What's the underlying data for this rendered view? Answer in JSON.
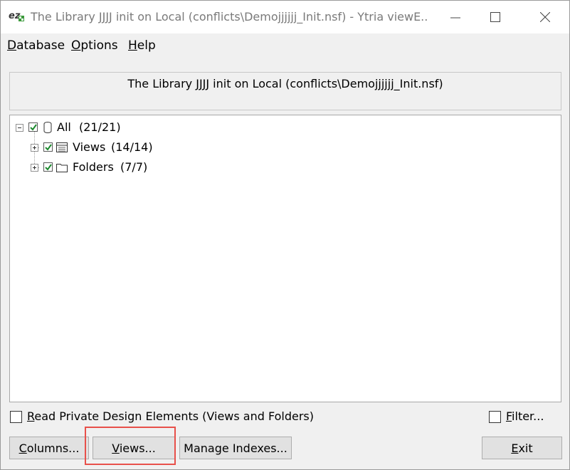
{
  "window": {
    "title": "The Library JJJJ init on Local (conflicts\\Demojjjjjj_Init.nsf) - Ytria viewE...",
    "app_icon": "ez-app-icon",
    "controls": [
      "minimize-icon",
      "maximize-icon",
      "close-icon"
    ]
  },
  "menu": {
    "items": [
      {
        "accel": "D",
        "rest": "atabase"
      },
      {
        "accel": "O",
        "rest": "ptions"
      },
      {
        "accel": "H",
        "rest": "elp"
      }
    ]
  },
  "header": {
    "text": "The Library JJJJ init on Local (conflicts\\Demojjjjjj_Init.nsf)"
  },
  "tree": {
    "root": {
      "label": "All",
      "count": "(21/21)",
      "checked": true,
      "icon": "database-icon",
      "expanded": true
    },
    "children": [
      {
        "label": "Views",
        "count": "(14/14)",
        "checked": true,
        "icon": "view-icon",
        "expanded": false
      },
      {
        "label": "Folders",
        "count": "(7/7)",
        "checked": true,
        "icon": "folder-icon",
        "expanded": false
      }
    ]
  },
  "options": {
    "read_private": {
      "accel": "R",
      "rest": "ead Private Design Elements (Views and Folders)",
      "checked": false
    },
    "filter": {
      "accel": "F",
      "rest": "ilter...",
      "checked": false
    }
  },
  "buttons": {
    "columns": {
      "accel": "C",
      "rest": "olumns..."
    },
    "views": {
      "accel": "V",
      "rest": "iews..."
    },
    "manage_indexes": {
      "label": "Manage Indexes..."
    },
    "exit": {
      "accel": "E",
      "rest": "xit"
    }
  },
  "colors": {
    "check_green": "#1c8a2e",
    "highlight_red": "#e8504a"
  }
}
